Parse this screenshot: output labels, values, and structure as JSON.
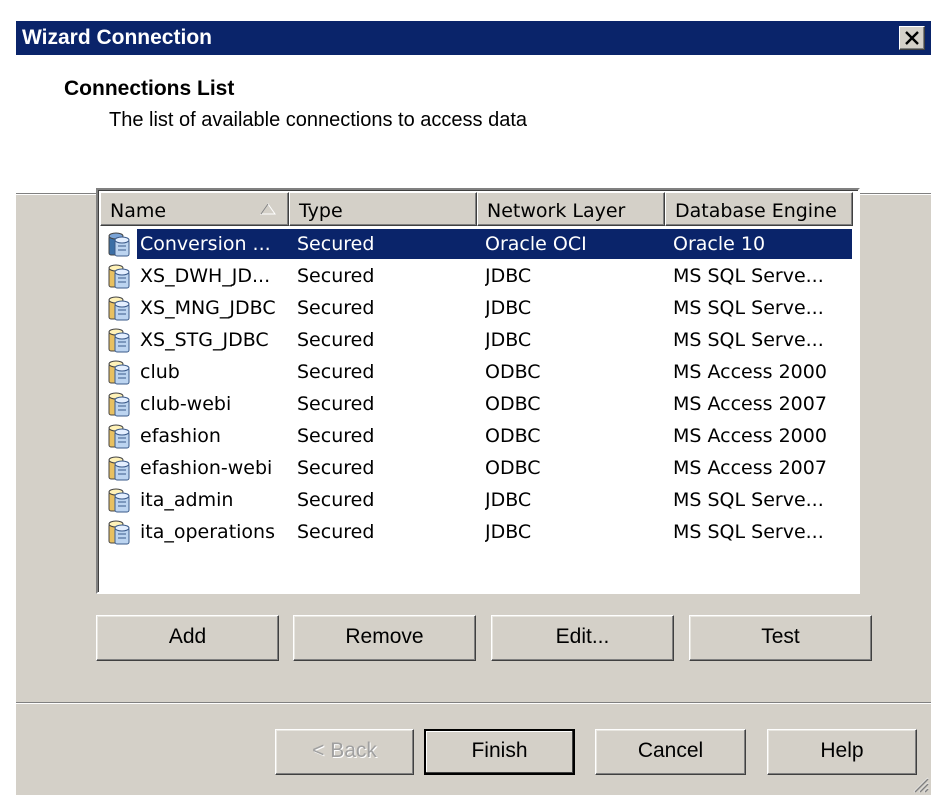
{
  "window": {
    "title": "Wizard Connection"
  },
  "header": {
    "title": "Connections List",
    "subtitle": "The list of available connections to access data"
  },
  "list": {
    "columns": [
      "Name",
      "Type",
      "Network Layer",
      "Database Engine"
    ],
    "sorted_column": "Name",
    "sort_direction": "ascending",
    "rows": [
      {
        "name": "Conversion ...",
        "type": "Secured",
        "network": "Oracle OCI",
        "engine": "Oracle 10",
        "selected": true
      },
      {
        "name": "XS_DWH_JD...",
        "type": "Secured",
        "network": "JDBC",
        "engine": "MS SQL Serve..."
      },
      {
        "name": "XS_MNG_JDBC",
        "type": "Secured",
        "network": "JDBC",
        "engine": "MS SQL Serve..."
      },
      {
        "name": "XS_STG_JDBC",
        "type": "Secured",
        "network": "JDBC",
        "engine": "MS SQL Serve..."
      },
      {
        "name": "club",
        "type": "Secured",
        "network": "ODBC",
        "engine": "MS Access 2000"
      },
      {
        "name": "club-webi",
        "type": "Secured",
        "network": "ODBC",
        "engine": "MS Access 2007"
      },
      {
        "name": "efashion",
        "type": "Secured",
        "network": "ODBC",
        "engine": "MS Access 2000"
      },
      {
        "name": "efashion-webi",
        "type": "Secured",
        "network": "ODBC",
        "engine": "MS Access 2007"
      },
      {
        "name": "ita_admin",
        "type": "Secured",
        "network": "JDBC",
        "engine": "MS SQL Serve..."
      },
      {
        "name": "ita_operations",
        "type": "Secured",
        "network": "JDBC",
        "engine": "MS SQL Serve..."
      }
    ]
  },
  "list_buttons": {
    "add": "Add",
    "remove": "Remove",
    "edit": "Edit...",
    "test": "Test"
  },
  "nav_buttons": {
    "back": "< Back",
    "finish": "Finish",
    "cancel": "Cancel",
    "help": "Help"
  },
  "colors": {
    "titlebar": "#0a246a",
    "selection": "#0a246a",
    "face": "#d4d0c8"
  },
  "icons": {
    "close": "close-icon",
    "connection": "database-connection-icon",
    "sort": "sort-ascending-icon",
    "grip": "resize-grip-icon"
  }
}
